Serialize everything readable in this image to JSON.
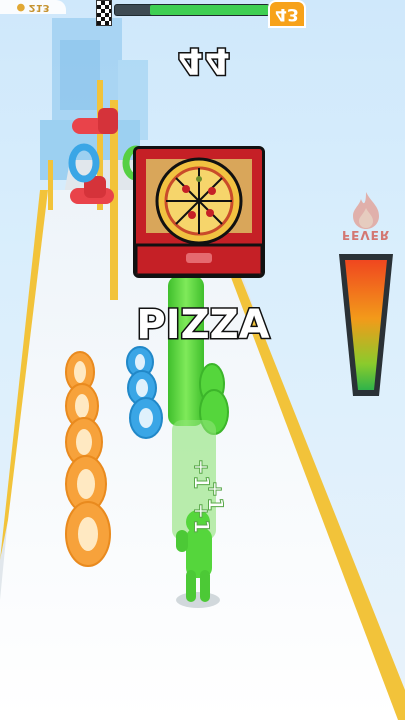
{
  "hud": {
    "coins": "213",
    "level": "43",
    "progress_fraction": 0.77
  },
  "score": "44",
  "fever": {
    "label": "FEVER",
    "level_fraction": 0.95
  },
  "collected_item": {
    "label": "PIZZA",
    "icon": "pizza-box-icon"
  },
  "floating_gains": [
    "+1",
    "+1",
    "+1"
  ],
  "colors": {
    "track": "#ffffff",
    "track_edge": "#f2c33a",
    "player": "#55d63c",
    "orange_rings": "#f7a23b",
    "blue_rings": "#3aa6e6",
    "card_red": "#c52026"
  }
}
